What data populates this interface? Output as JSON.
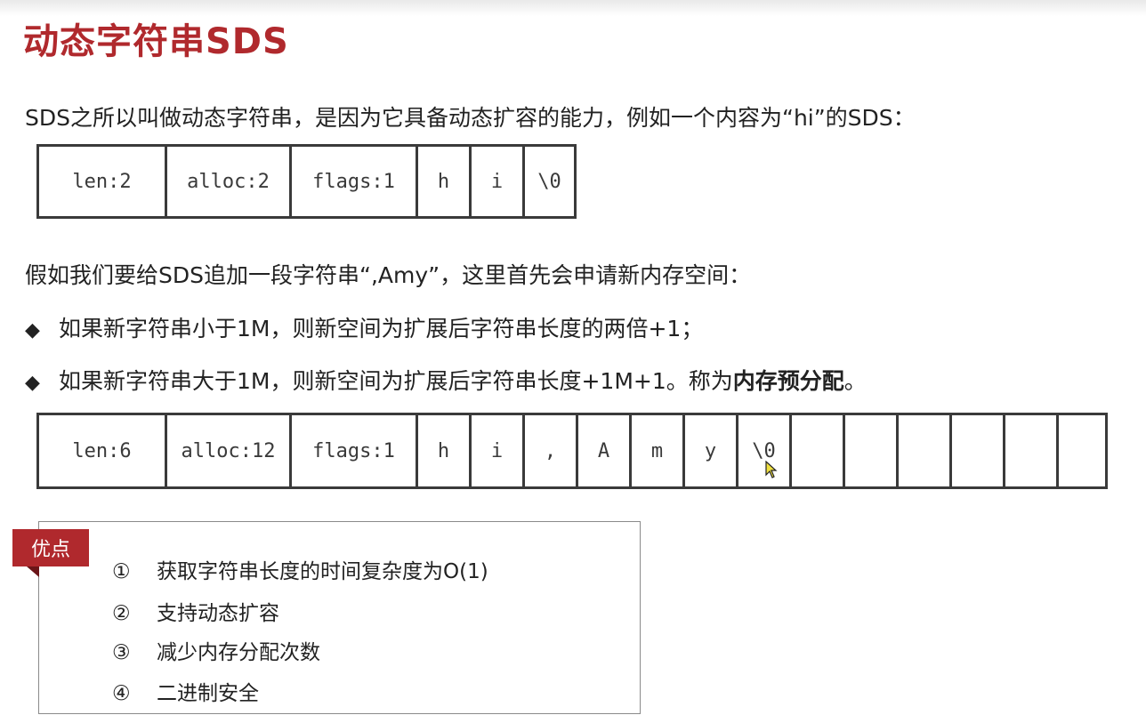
{
  "title": "动态字符串SDS",
  "intro": "SDS之所以叫做动态字符串，是因为它具备动态扩容的能力，例如一个内容为“hi”的SDS：",
  "sds_before": [
    "len:2",
    "alloc:2",
    "flags:1",
    "h",
    "i",
    "\\0"
  ],
  "append_text": "假如我们要给SDS追加一段字符串“,Amy”，这里首先会申请新内存空间：",
  "bullets": {
    "marker": "◆",
    "b1": "如果新字符串小于1M，则新空间为扩展后字符串长度的两倍+1；",
    "b2_prefix": "如果新字符串大于1M，则新空间为扩展后字符串长度+1M+1。称为",
    "b2_bold": "内存预分配",
    "b2_suffix": "。"
  },
  "sds_after": [
    "len:6",
    "alloc:12",
    "flags:1",
    "h",
    "i",
    ",",
    "A",
    "m",
    "y",
    "\\0",
    "",
    "",
    "",
    "",
    "",
    ""
  ],
  "advantages": {
    "tag": "优点",
    "items": [
      {
        "num": "①",
        "text": "获取字符串长度的时间复杂度为O(1)"
      },
      {
        "num": "②",
        "text": "支持动态扩容"
      },
      {
        "num": "③",
        "text": "减少内存分配次数"
      },
      {
        "num": "④",
        "text": "二进制安全"
      }
    ]
  },
  "colors": {
    "accent": "#b0292d",
    "border": "#3a3a3a"
  }
}
